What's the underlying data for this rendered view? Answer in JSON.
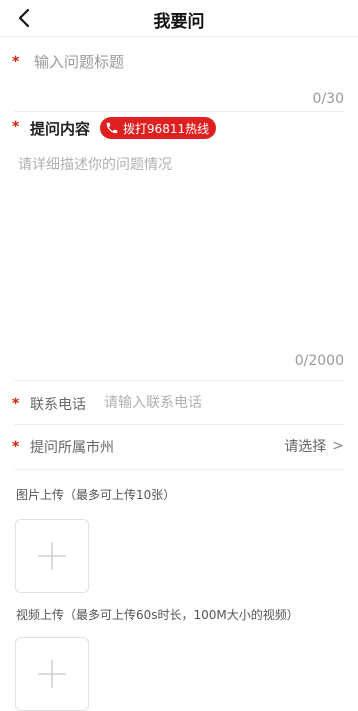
{
  "header": {
    "title": "我要问"
  },
  "form": {
    "required_mark": "*",
    "title_field": {
      "placeholder": "输入问题标题",
      "value": "",
      "counter": "0/30"
    },
    "content_field": {
      "label": "提问内容",
      "hotline_label": "拨打96811热线",
      "placeholder": "请详细描述你的问题情况",
      "value": "",
      "counter": "0/2000"
    },
    "phone_field": {
      "label": "联系电话",
      "placeholder": "请输入联系电话",
      "value": ""
    },
    "region_field": {
      "label": "提问所属市州",
      "value": "请选择",
      "chevron": ">"
    },
    "image_upload": {
      "caption": "图片上传（最多可上传10张）"
    },
    "video_upload": {
      "caption": "视频上传（最多可上传60s时长，100M大小的视频）"
    }
  },
  "colors": {
    "required": "#d81e06",
    "hotline_bg": "#e02020",
    "placeholder": "#b0b0b0",
    "divider": "#eeeeee"
  },
  "icons": {
    "back": "back-arrow-icon",
    "phone": "phone-icon",
    "plus": "plus-icon",
    "chevron": "chevron-right-icon"
  }
}
